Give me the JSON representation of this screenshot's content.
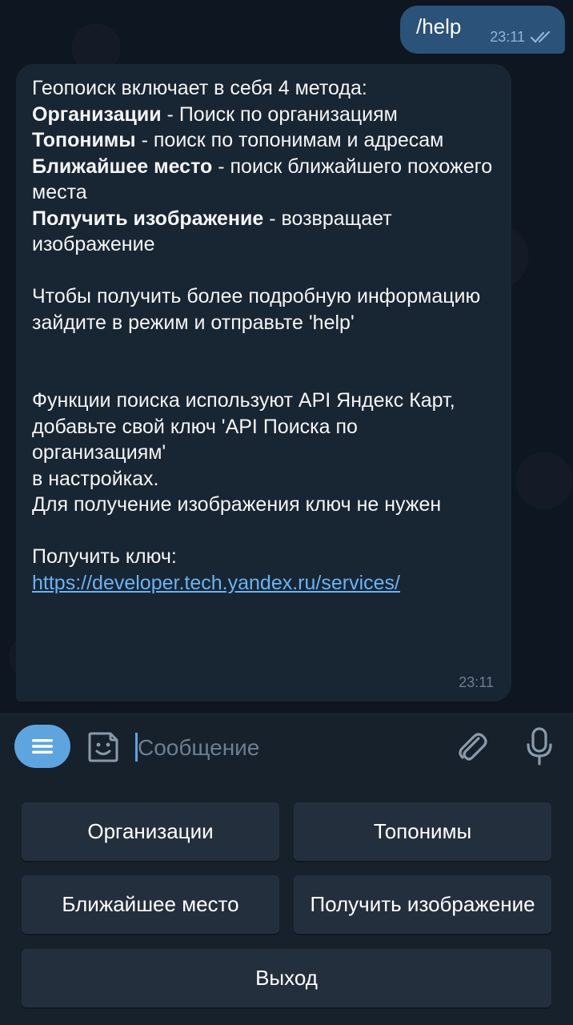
{
  "outgoing": {
    "text": "/help",
    "time": "23:11"
  },
  "incoming": {
    "intro": "Геопоиск включает в себя 4 метода:",
    "methods": [
      {
        "name": "Организации",
        "desc": " - Поиск по организациям"
      },
      {
        "name": "Топонимы",
        "desc": " - поиск по топонимам и адресам"
      },
      {
        "name": "Ближайшее место",
        "desc": " - поиск ближайшего похожего места"
      },
      {
        "name": "Получить изображение",
        "desc": " - возвращает изображение"
      }
    ],
    "details_line1": "Чтобы получить более подробную информацию",
    "details_line2": "зайдите в режим и отправьте 'help'",
    "api_line1": "Функции поиска используют API Яндекс Карт,",
    "api_line2": "добавьте свой ключ 'API Поиска по организациям'",
    "api_line3": "в настройках.",
    "api_line4": "Для получение изображения ключ не нужен",
    "key_label": "Получить ключ:",
    "key_link": "https://developer.tech.yandex.ru/services/",
    "time": "23:11"
  },
  "input": {
    "placeholder": "Сообщение"
  },
  "keyboard": {
    "organizations": "Организации",
    "toponyms": "Топонимы",
    "nearest": "Ближайшее место",
    "get_image": "Получить изображение",
    "exit": "Выход"
  },
  "colors": {
    "accent": "#5ea5e0",
    "link": "#6ab3f3",
    "outgoing_bubble": "#2b5278"
  }
}
